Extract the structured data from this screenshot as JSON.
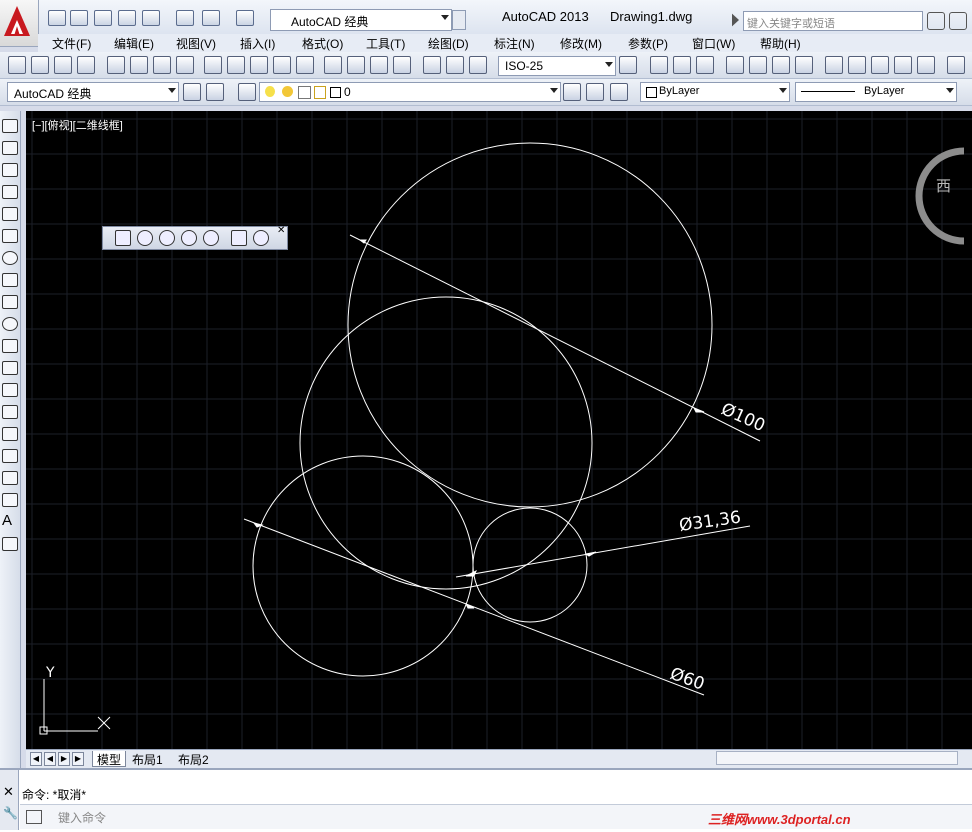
{
  "titlebar": {
    "app_title": "AutoCAD 2013",
    "document": "Drawing1.dwg",
    "workspace": "AutoCAD 经典",
    "search_placeholder": "键入关键字或短语"
  },
  "menu": [
    "文件(F)",
    "编辑(E)",
    "视图(V)",
    "插入(I)",
    "格式(O)",
    "工具(T)",
    "绘图(D)",
    "标注(N)",
    "修改(M)",
    "参数(P)",
    "窗口(W)",
    "帮助(H)"
  ],
  "toolbar": {
    "dimstyle": "ISO-25",
    "workspace": "AutoCAD 经典",
    "layer": "0",
    "color": "ByLayer",
    "linetype": "ByLayer"
  },
  "viewport_label": "[−][俯视][二维线框]",
  "viewcube_label": "西",
  "dimensions": {
    "large": "Ø100",
    "small": "Ø31,36",
    "medium": "Ø60"
  },
  "ucs": {
    "x": "X",
    "y": "Y"
  },
  "tabs": [
    "模型",
    "布局1",
    "布局2"
  ],
  "command": {
    "history": "命令: *取消*",
    "placeholder": "键入命令"
  },
  "watermark": "三维网www.3dportal.cn",
  "colors": {
    "canvas": "#000000",
    "geometry": "#ffffff",
    "grid": "#1c1f28",
    "watermark": "#dd2222"
  }
}
